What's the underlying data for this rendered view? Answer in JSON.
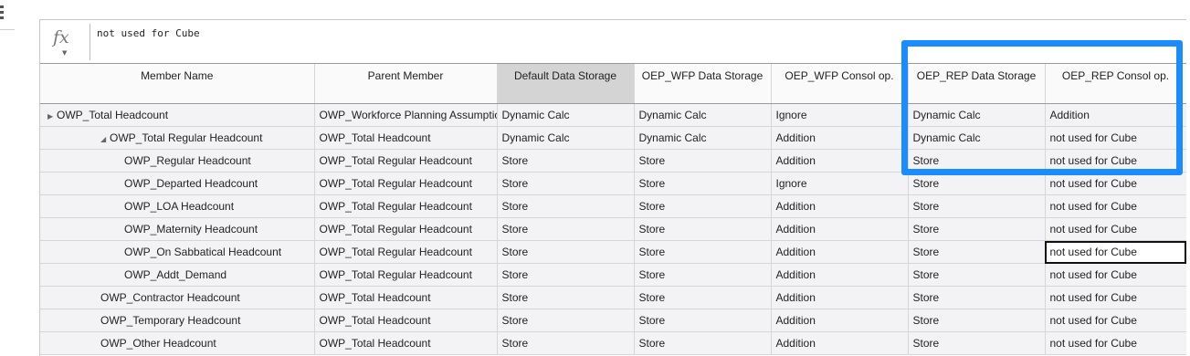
{
  "formula_bar": {
    "icon": "fx-icon",
    "value": "not used for Cube"
  },
  "columns": [
    "Member Name",
    "Parent Member",
    "Default Data Storage",
    "OEP_WFP Data Storage",
    "OEP_WFP Consol op.",
    "OEP_REP Data Storage",
    "OEP_REP Consol op."
  ],
  "rows": [
    {
      "member": "OWP_Total Headcount",
      "parent": "OWP_Workforce Planning Assumptions",
      "default_storage": "Dynamic Calc",
      "wfp_storage": "Dynamic Calc",
      "wfp_consol": "Ignore",
      "rep_storage": "Dynamic Calc",
      "rep_consol": "Addition",
      "indent": 0,
      "toggle": "▶"
    },
    {
      "member": "OWP_Total Regular Headcount",
      "parent": "OWP_Total Headcount",
      "default_storage": "Dynamic Calc",
      "wfp_storage": "Dynamic Calc",
      "wfp_consol": "Addition",
      "rep_storage": "Dynamic Calc",
      "rep_consol": "not used for Cube",
      "indent": 1,
      "toggle": "◢"
    },
    {
      "member": "OWP_Regular Headcount",
      "parent": "OWP_Total Regular Headcount",
      "default_storage": "Store",
      "wfp_storage": "Store",
      "wfp_consol": "Addition",
      "rep_storage": "Store",
      "rep_consol": "not used for Cube",
      "indent": 2,
      "toggle": ""
    },
    {
      "member": "OWP_Departed Headcount",
      "parent": "OWP_Total Regular Headcount",
      "default_storage": "Store",
      "wfp_storage": "Store",
      "wfp_consol": "Ignore",
      "rep_storage": "Store",
      "rep_consol": "not used for Cube",
      "indent": 2,
      "toggle": ""
    },
    {
      "member": "OWP_LOA Headcount",
      "parent": "OWP_Total Regular Headcount",
      "default_storage": "Store",
      "wfp_storage": "Store",
      "wfp_consol": "Addition",
      "rep_storage": "Store",
      "rep_consol": "not used for Cube",
      "indent": 2,
      "toggle": ""
    },
    {
      "member": "OWP_Maternity Headcount",
      "parent": "OWP_Total Regular Headcount",
      "default_storage": "Store",
      "wfp_storage": "Store",
      "wfp_consol": "Addition",
      "rep_storage": "Store",
      "rep_consol": "not used for Cube",
      "indent": 2,
      "toggle": ""
    },
    {
      "member": "OWP_On Sabbatical Headcount",
      "parent": "OWP_Total Regular Headcount",
      "default_storage": "Store",
      "wfp_storage": "Store",
      "wfp_consol": "Addition",
      "rep_storage": "Store",
      "rep_consol": "not used for Cube",
      "indent": 2,
      "toggle": "",
      "active": true
    },
    {
      "member": "OWP_Addt_Demand",
      "parent": "OWP_Total Regular Headcount",
      "default_storage": "Store",
      "wfp_storage": "Store",
      "wfp_consol": "Addition",
      "rep_storage": "Store",
      "rep_consol": "not used for Cube",
      "indent": 2,
      "toggle": ""
    },
    {
      "member": "OWP_Contractor Headcount",
      "parent": "OWP_Total Headcount",
      "default_storage": "Store",
      "wfp_storage": "Store",
      "wfp_consol": "Addition",
      "rep_storage": "Store",
      "rep_consol": "not used for Cube",
      "indent": 1,
      "toggle": ""
    },
    {
      "member": "OWP_Temporary Headcount",
      "parent": "OWP_Total Headcount",
      "default_storage": "Store",
      "wfp_storage": "Store",
      "wfp_consol": "Addition",
      "rep_storage": "Store",
      "rep_consol": "not used for Cube",
      "indent": 1,
      "toggle": ""
    },
    {
      "member": "OWP_Other Headcount",
      "parent": "OWP_Total Headcount",
      "default_storage": "Store",
      "wfp_storage": "Store",
      "wfp_consol": "Addition",
      "rep_storage": "Store",
      "rep_consol": "not used for Cube",
      "indent": 1,
      "toggle": ""
    }
  ],
  "colors": {
    "highlight": "#1a8cff",
    "selected_header": "#d4d4d4",
    "cell_bg": "#f3f3f5"
  }
}
